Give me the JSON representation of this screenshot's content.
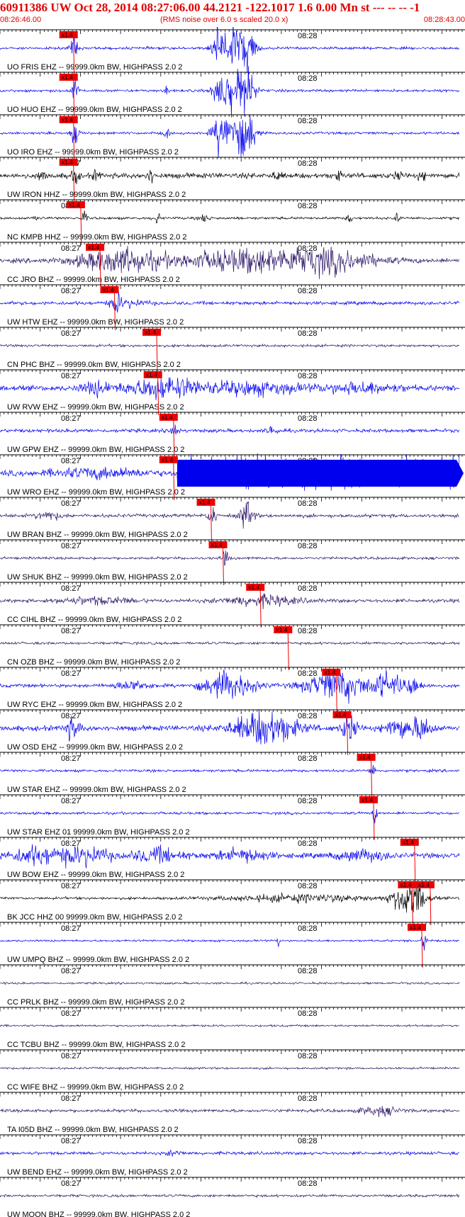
{
  "header": {
    "title": "60911386 UW Oct 28, 2014 08:27:06.00   44.2121 -122.1017  1.6 0.00 Mn st --- -- --  -1",
    "start_time": "08:26:46.00",
    "rms_note": "(RMS noise over 6.0 s scaled 20.0 x)",
    "end_time": "08:28:43.00"
  },
  "colors": {
    "header_text": "#e00000",
    "trace_blue": "#0000ee",
    "trace_navy": "#2b1466",
    "trace_black": "#000000",
    "pick_marker": "#ee0000",
    "axis": "#000000"
  },
  "chart_data": {
    "type": "line",
    "x_range": [
      "08:26:46.00",
      "08:28:43.00"
    ],
    "time_ticks": [
      "08:27",
      "08:28"
    ],
    "pick_label": "x1.4",
    "traces": [
      {
        "label": "UO FRIS EHZ -- 99999.0km BW, HIGHPASS  2.0  2",
        "tick_label": "08:2",
        "pick_s": 61,
        "color": "blue",
        "noise": 1.5,
        "events": [
          [
            62,
            3,
            14
          ],
          [
            183,
            2,
            16
          ],
          [
            186,
            8,
            30
          ],
          [
            196,
            8,
            30
          ],
          [
            206,
            6,
            30
          ]
        ]
      },
      {
        "label": "UO HUO EHZ -- 99999.0km BW, HIGHPASS  2.0  2",
        "tick_label": "08:2",
        "pick_s": 61,
        "color": "blue",
        "noise": 1.5,
        "events": [
          [
            62,
            3,
            14
          ],
          [
            138,
            2,
            5
          ],
          [
            183,
            2,
            16
          ],
          [
            186,
            8,
            30
          ],
          [
            196,
            8,
            30
          ],
          [
            206,
            6,
            30
          ]
        ]
      },
      {
        "label": "UO IRO EHZ -- 99999.0km BW, HIGHPASS  2.0  2",
        "tick_label": "08:2",
        "pick_s": 61,
        "color": "blue",
        "noise": 1.5,
        "events": [
          [
            62,
            3,
            16
          ],
          [
            138,
            2,
            6
          ],
          [
            183,
            2,
            16
          ],
          [
            186,
            8,
            30
          ],
          [
            196,
            8,
            30
          ],
          [
            206,
            6,
            30
          ]
        ]
      },
      {
        "label": "UW IRON HHZ -- 99999.0km BW, HIGHPASS  2.0  2",
        "tick_label": "08:27",
        "pick_s": 61,
        "color": "black",
        "noise": 3,
        "events": [
          [
            35,
            3,
            6
          ],
          [
            62,
            3,
            10
          ],
          [
            80,
            3,
            5
          ],
          [
            125,
            3,
            8
          ],
          [
            230,
            3,
            6
          ],
          [
            280,
            3,
            5
          ],
          [
            330,
            3,
            5
          ],
          [
            350,
            3,
            5
          ]
        ]
      },
      {
        "label": "NC KMPB HHZ -- 99999.0km BW, HIGHPASS  2.0  2",
        "tick_label": "08:27",
        "pick_s": 67,
        "color": "black",
        "noise": 1.5,
        "events": [
          [
            30,
            2,
            4
          ],
          [
            70,
            2,
            8
          ],
          [
            130,
            3,
            6
          ],
          [
            170,
            3,
            6
          ],
          [
            290,
            2,
            6
          ],
          [
            330,
            2,
            5
          ]
        ]
      },
      {
        "label": "CC JRO BHZ -- 99999.0km BW, HIGHPASS  2.0  2",
        "tick_label": "08:27",
        "pick_s": 83,
        "color": "navy",
        "noise": 2.5,
        "events": [
          [
            100,
            35,
            14
          ],
          [
            200,
            50,
            12
          ],
          [
            270,
            40,
            13
          ]
        ]
      },
      {
        "label": "UW HTW EHZ -- 99999.0km BW, HIGHPASS  2.0  2",
        "tick_label": "08:27",
        "pick_s": 95,
        "color": "blue",
        "noise": 2,
        "events": [
          [
            97,
            3,
            12
          ],
          [
            105,
            15,
            4
          ]
        ]
      },
      {
        "label": "CN PHC BHZ -- 99999.0km BW, HIGHPASS  2.0  2",
        "tick_label": "08:27",
        "pick_s": 130,
        "color": "navy",
        "noise": 1.5,
        "events": []
      },
      {
        "label": "UW RVW EHZ -- 99999.0km BW, HIGHPASS  2.0  2",
        "tick_label": "08:27",
        "pick_s": 131,
        "color": "blue",
        "noise": 3,
        "events": [
          [
            80,
            12,
            7
          ],
          [
            135,
            30,
            12
          ],
          [
            210,
            40,
            7
          ],
          [
            300,
            30,
            6
          ]
        ]
      },
      {
        "label": "UW GPW EHZ -- 99999.0km BW, HIGHPASS  2.0  2",
        "tick_label": "08:27",
        "pick_s": 144,
        "color": "blue",
        "noise": 2,
        "events": [
          [
            145,
            3,
            8
          ],
          [
            226,
            4,
            6
          ]
        ]
      },
      {
        "label": "UW WRO EHZ -- 99999.0km BW, HIGHPASS  2.0  2",
        "tick_label": "08:27",
        "pick_s": 144,
        "color": "blue",
        "noise": 3,
        "events": [
          [
            80,
            40,
            5
          ]
        ],
        "saturated_from_s": 147
      },
      {
        "label": "UW BRAN BHZ -- 99999.0km BW, HIGHPASS  2.0  2",
        "tick_label": "08:27",
        "pick_s": 175,
        "color": "navy",
        "noise": 2,
        "events": [
          [
            40,
            10,
            5
          ],
          [
            176,
            3,
            14
          ],
          [
            205,
            5,
            18
          ]
        ]
      },
      {
        "label": "UW SHUK BHZ -- 99999.0km BW, HIGHPASS  2.0  2",
        "tick_label": "08:27",
        "pick_s": 185,
        "color": "navy",
        "noise": 1.5,
        "events": [
          [
            187,
            3,
            8
          ]
        ]
      },
      {
        "label": "CC CIHL BHZ -- 99999.0km BW, HIGHPASS  2.0  2",
        "tick_label": "08:27",
        "pick_s": 216,
        "color": "navy",
        "noise": 2,
        "events": [
          [
            80,
            30,
            4
          ],
          [
            217,
            30,
            6
          ]
        ]
      },
      {
        "label": "CN OZB BHZ -- 99999.0km BW, HIGHPASS  2.0  2",
        "tick_label": "08:27",
        "pick_s": 239,
        "color": "navy",
        "noise": 1.5,
        "events": []
      },
      {
        "label": "UW RYC EHZ -- 99999.0km BW, HIGHPASS  2.0  2",
        "tick_label": "08:27",
        "pick_s": 279,
        "color": "blue",
        "noise": 2,
        "events": [
          [
            110,
            15,
            5
          ],
          [
            190,
            20,
            16
          ],
          [
            280,
            25,
            18
          ],
          [
            320,
            10,
            14
          ],
          [
            340,
            10,
            10
          ]
        ]
      },
      {
        "label": "UW OSD EHZ -- 99999.0km BW, HIGHPASS  2.0  2",
        "tick_label": "08:27",
        "pick_s": 288,
        "color": "blue",
        "noise": 3,
        "events": [
          [
            60,
            6,
            12
          ],
          [
            220,
            25,
            20
          ],
          [
            290,
            6,
            16
          ],
          [
            330,
            10,
            12
          ],
          [
            350,
            8,
            14
          ]
        ]
      },
      {
        "label": "UW STAR EHZ -- 99999.0km BW, HIGHPASS  2.0  2",
        "tick_label": "08:27",
        "pick_s": 308,
        "color": "blue",
        "noise": 1.5,
        "events": [
          [
            309,
            2,
            10
          ]
        ]
      },
      {
        "label": "UW STAR EHZ 01 99999.0km BW, HIGHPASS  2.0  2",
        "tick_label": "08:27",
        "pick_s": 310,
        "color": "blue",
        "noise": 1.5,
        "events": [
          [
            311,
            2,
            10
          ]
        ]
      },
      {
        "label": "UW BOW EHZ -- 99999.0km BW, HIGHPASS  2.0  2",
        "tick_label": "08:27",
        "pick_s": 344,
        "color": "blue",
        "noise": 3,
        "events": [
          [
            30,
            20,
            10
          ],
          [
            70,
            20,
            10
          ],
          [
            130,
            20,
            8
          ],
          [
            200,
            20,
            7
          ],
          [
            300,
            20,
            6
          ]
        ]
      },
      {
        "label": "BK JCC HHZ 00 99999.0km BW, HIGHPASS  2.0  2",
        "tick_label": "08:27",
        "pick_s": 342,
        "color": "black",
        "noise": 1.5,
        "events": [
          [
            250,
            60,
            4
          ],
          [
            340,
            12,
            26
          ]
        ],
        "extra_pick_s": 357
      },
      {
        "label": "UW UMPQ BHZ -- 99999.0km BW, HIGHPASS  2.0  2",
        "tick_label": "08:27",
        "pick_s": 350,
        "color": "blue",
        "noise": 1.2,
        "events": [
          [
            231,
            1,
            10
          ],
          [
            352,
            2,
            12
          ]
        ]
      },
      {
        "label": "CC PRLK BHZ -- 99999.0km BW, HIGHPASS  2.0  2",
        "tick_label": "08:27",
        "pick_s": null,
        "color": "navy",
        "noise": 1.2,
        "events": []
      },
      {
        "label": "CC TCBU BHZ -- 99999.0km BW, HIGHPASS  2.0  2",
        "tick_label": "08:27",
        "pick_s": null,
        "color": "navy",
        "noise": 1.2,
        "events": []
      },
      {
        "label": "CC WIFE BHZ -- 99999.0km BW, HIGHPASS  2.0  2",
        "tick_label": "08:27",
        "pick_s": null,
        "color": "navy",
        "noise": 1.2,
        "events": []
      },
      {
        "label": "TA I05D BHZ -- 99999.0km BW, HIGHPASS  2.0  2",
        "tick_label": "08:27",
        "pick_s": null,
        "color": "navy",
        "noise": 1.8,
        "events": [
          [
            315,
            15,
            5
          ]
        ]
      },
      {
        "label": "UW BEND EHZ -- 99999.0km BW, HIGHPASS  2.0  2",
        "tick_label": "08:27",
        "pick_s": null,
        "color": "blue",
        "noise": 1.8,
        "events": [
          [
            145,
            6,
            3
          ]
        ]
      },
      {
        "label": "UW MOON BHZ -- 99999.0km BW, HIGHPASS  2.0  2",
        "tick_label": "08:27",
        "pick_s": null,
        "color": "navy",
        "noise": 1.5,
        "events": []
      }
    ]
  }
}
